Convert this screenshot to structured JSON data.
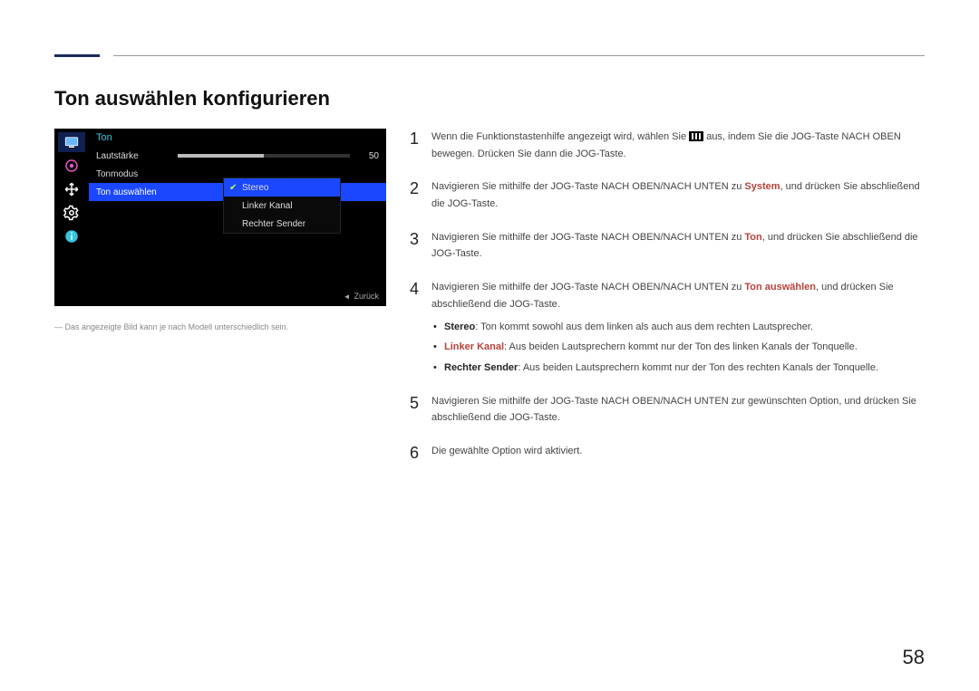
{
  "title": "Ton auswählen konfigurieren",
  "osd": {
    "panel_title": "Ton",
    "rows": {
      "volume_label": "Lautstärke",
      "volume_value": "50",
      "mode_label": "Tonmodus",
      "select_label": "Ton auswählen"
    },
    "submenu": {
      "opt1": "Stereo",
      "opt2": "Linker Kanal",
      "opt3": "Rechter Sender"
    },
    "back": "Zurück"
  },
  "note": "Das angezeigte Bild kann je nach Modell unterschiedlich sein.",
  "steps": {
    "s1a": "Wenn die Funktionstastenhilfe angezeigt wird, wählen Sie ",
    "s1b": " aus, indem Sie die JOG-Taste NACH OBEN bewegen. Drücken Sie dann die JOG-Taste.",
    "s2a": "Navigieren Sie mithilfe der JOG-Taste NACH OBEN/NACH UNTEN zu ",
    "s2h": "System",
    "s2b": ", und drücken Sie abschließend die JOG-Taste.",
    "s3a": "Navigieren Sie mithilfe der JOG-Taste NACH OBEN/NACH UNTEN zu ",
    "s3h": "Ton",
    "s3b": ", und drücken Sie abschließend die JOG-Taste.",
    "s4a": "Navigieren Sie mithilfe der JOG-Taste NACH OBEN/NACH UNTEN zu ",
    "s4h": "Ton auswählen",
    "s4b": ", und drücken Sie abschließend die JOG-Taste.",
    "b1h": "Stereo",
    "b1t": ": Ton kommt sowohl aus dem linken als auch aus dem rechten Lautsprecher.",
    "b2h": "Linker Kanal",
    "b2t": ": Aus beiden Lautsprechern kommt nur der Ton des linken Kanals der Tonquelle.",
    "b3h": "Rechter Sender",
    "b3t": ": Aus beiden Lautsprechern kommt nur der Ton des rechten Kanals der Tonquelle.",
    "s5": "Navigieren Sie mithilfe der JOG-Taste NACH OBEN/NACH UNTEN zur gewünschten Option, und drücken Sie abschließend die JOG-Taste.",
    "s6": "Die gewählte Option wird aktiviert."
  },
  "page_number": "58"
}
